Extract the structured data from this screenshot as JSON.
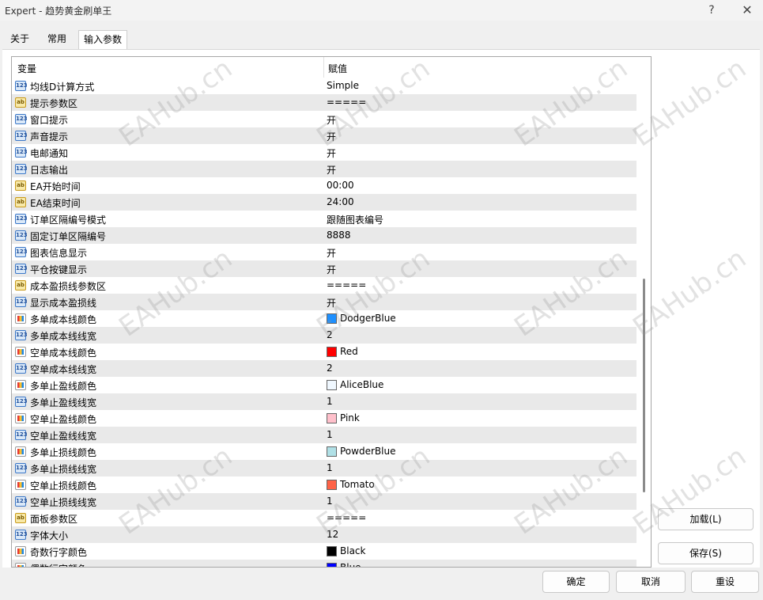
{
  "window": {
    "title": "Expert - 趋势黄金刷单王",
    "help_glyph": "?",
    "close_glyph": "✕"
  },
  "tabs": [
    "关于",
    "常用",
    "输入参数"
  ],
  "grid": {
    "col_variable": "变量",
    "col_value": "赋值",
    "rows": [
      {
        "type": "num",
        "name": "均线D计算方式",
        "value": "Simple"
      },
      {
        "type": "str",
        "name": "提示参数区",
        "value": "====="
      },
      {
        "type": "num",
        "name": "窗口提示",
        "value": "开"
      },
      {
        "type": "num",
        "name": "声音提示",
        "value": "开"
      },
      {
        "type": "num",
        "name": "电邮通知",
        "value": "开"
      },
      {
        "type": "num",
        "name": "日志输出",
        "value": "开"
      },
      {
        "type": "str",
        "name": "EA开始时间",
        "value": "00:00"
      },
      {
        "type": "str",
        "name": "EA结束时间",
        "value": "24:00"
      },
      {
        "type": "num",
        "name": "订单区隔编号模式",
        "value": "跟随图表编号"
      },
      {
        "type": "num",
        "name": "固定订单区隔编号",
        "value": "8888"
      },
      {
        "type": "num",
        "name": "图表信息显示",
        "value": "开"
      },
      {
        "type": "num",
        "name": "平仓按键显示",
        "value": "开"
      },
      {
        "type": "str",
        "name": "成本盈损线参数区",
        "value": "====="
      },
      {
        "type": "num",
        "name": "显示成本盈损线",
        "value": "开"
      },
      {
        "type": "color",
        "name": "多单成本线颜色",
        "value": "DodgerBlue",
        "color": "#1e90ff"
      },
      {
        "type": "num",
        "name": "多单成本线线宽",
        "value": "2"
      },
      {
        "type": "color",
        "name": "空单成本线颜色",
        "value": "Red",
        "color": "#ff0000"
      },
      {
        "type": "num",
        "name": "空单成本线线宽",
        "value": "2"
      },
      {
        "type": "color",
        "name": "多单止盈线颜色",
        "value": "AliceBlue",
        "color": "#f0f8ff"
      },
      {
        "type": "num",
        "name": "多单止盈线线宽",
        "value": "1"
      },
      {
        "type": "color",
        "name": "空单止盈线颜色",
        "value": "Pink",
        "color": "#ffc0cb"
      },
      {
        "type": "num",
        "name": "空单止盈线线宽",
        "value": "1"
      },
      {
        "type": "color",
        "name": "多单止损线颜色",
        "value": "PowderBlue",
        "color": "#b0e0e6"
      },
      {
        "type": "num",
        "name": "多单止损线线宽",
        "value": "1"
      },
      {
        "type": "color",
        "name": "空单止损线颜色",
        "value": "Tomato",
        "color": "#ff6347"
      },
      {
        "type": "num",
        "name": "空单止损线线宽",
        "value": "1"
      },
      {
        "type": "str",
        "name": "面板参数区",
        "value": "====="
      },
      {
        "type": "num",
        "name": "字体大小",
        "value": "12"
      },
      {
        "type": "color",
        "name": "奇数行字颜色",
        "value": "Black",
        "color": "#000000"
      },
      {
        "type": "color",
        "name": "偶数行字颜色",
        "value": "Blue",
        "color": "#0000ff"
      }
    ]
  },
  "buttons": {
    "load": "加载(L)",
    "save": "保存(S)",
    "ok": "确定",
    "cancel": "取消",
    "reset": "重设"
  },
  "watermark": "EAHub.cn"
}
